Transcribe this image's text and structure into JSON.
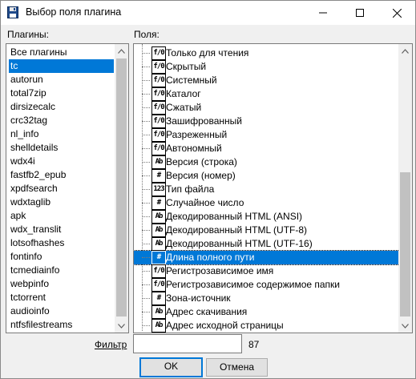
{
  "window": {
    "title": "Выбор поля плагина"
  },
  "plugins": {
    "label": "Плагины:",
    "items": [
      "Все плагины",
      "tc",
      "autorun",
      "total7zip",
      "dirsizecalc",
      "crc32tag",
      "nl_info",
      "shelldetails",
      "wdx4i",
      "fastfb2_epub",
      "xpdfsearch",
      "wdxtaglib",
      "apk",
      "wdx_translit",
      "lotsofhashes",
      "fontinfo",
      "tcmediainfo",
      "webpinfo",
      "tctorrent",
      "audioinfo",
      "ntfsfilestreams"
    ],
    "selected_index": 1
  },
  "fields": {
    "label": "Поля:",
    "items": [
      {
        "icon": "f/0",
        "label": "Только для чтения"
      },
      {
        "icon": "f/0",
        "label": "Скрытый"
      },
      {
        "icon": "f/0",
        "label": "Системный"
      },
      {
        "icon": "f/0",
        "label": "Каталог"
      },
      {
        "icon": "f/0",
        "label": "Сжатый"
      },
      {
        "icon": "f/0",
        "label": "Зашифрованный"
      },
      {
        "icon": "f/0",
        "label": "Разреженный"
      },
      {
        "icon": "f/0",
        "label": "Автономный"
      },
      {
        "icon": "Ab",
        "label": "Версия (строка)"
      },
      {
        "icon": "#",
        "label": "Версия (номер)"
      },
      {
        "icon": "123",
        "label": "Тип файла"
      },
      {
        "icon": "#",
        "label": "Случайное число"
      },
      {
        "icon": "Ab",
        "label": "Декодированный HTML (ANSI)"
      },
      {
        "icon": "Ab",
        "label": "Декодированный HTML (UTF-8)"
      },
      {
        "icon": "Ab",
        "label": "Декодированный HTML (UTF-16)"
      },
      {
        "icon": "#",
        "label": "Длина полного пути"
      },
      {
        "icon": "f/0",
        "label": "Регистрозависимое имя"
      },
      {
        "icon": "f/0",
        "label": "Регистрозависимое содержимое папки"
      },
      {
        "icon": "#",
        "label": "Зона-источник"
      },
      {
        "icon": "Ab",
        "label": "Адрес скачивания"
      },
      {
        "icon": "Ab",
        "label": "Адрес исходной страницы"
      }
    ],
    "selected_index": 15
  },
  "filter": {
    "label": "Фильтр",
    "value": "",
    "count": "87"
  },
  "buttons": {
    "ok": "OK",
    "cancel": "Отмена"
  }
}
